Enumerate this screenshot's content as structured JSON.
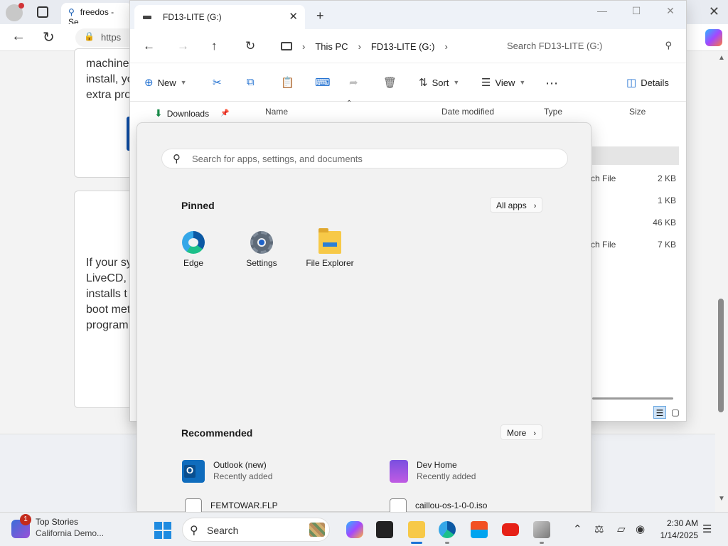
{
  "browser": {
    "tab_title": "freedos - Se",
    "url_text": "https",
    "card1_lines": [
      "machine",
      "install, yo",
      "extra pro"
    ],
    "card2_lines": [
      "If your sy",
      "LiveCD, t",
      "installs t",
      "boot met",
      "program"
    ]
  },
  "explorer": {
    "tab_title": "FD13-LITE (G:)",
    "breadcrumb": [
      "This PC",
      "FD13-LITE (G:)"
    ],
    "search_placeholder": "Search FD13-LITE (G:)",
    "commands": {
      "new": "New",
      "sort": "Sort",
      "view": "View",
      "details": "Details"
    },
    "columns": {
      "name": "Name",
      "date_modified": "Date modified",
      "type": "Type",
      "size": "Size"
    },
    "nav_downloads": "Downloads",
    "rows": [
      {
        "type": "ch File",
        "size": "2 KB"
      },
      {
        "type": "",
        "size": "1 KB"
      },
      {
        "type": "",
        "size": "46 KB"
      },
      {
        "type": "ch File",
        "size": "7 KB"
      }
    ]
  },
  "start_menu": {
    "search_placeholder": "Search for apps, settings, and documents",
    "pinned_heading": "Pinned",
    "all_apps_label": "All apps",
    "pinned": [
      {
        "label": "Edge",
        "icon": "edge-icon"
      },
      {
        "label": "Settings",
        "icon": "settings-gear-icon"
      },
      {
        "label": "File Explorer",
        "icon": "folder-icon"
      }
    ],
    "recommended_heading": "Recommended",
    "more_label": "More",
    "recommended": [
      {
        "title": "Outlook (new)",
        "subtitle": "Recently added",
        "icon": "outlook-icon"
      },
      {
        "title": "Dev Home",
        "subtitle": "Recently added",
        "icon": "dev-home-icon"
      },
      {
        "title": "FEMTOWAR.FLP",
        "subtitle": "",
        "icon": "file-icon"
      },
      {
        "title": "caillou-os-1-0-0.iso",
        "subtitle": "",
        "icon": "disc-image-icon"
      }
    ]
  },
  "taskbar": {
    "widget_title": "Top Stories",
    "widget_subtitle": "California Demo...",
    "widget_badge": "1",
    "search_label": "Search",
    "time": "2:30 AM",
    "date": "1/14/2025"
  },
  "colors": {
    "accent": "#1f6fd0",
    "windows_blue": "#1f8be0",
    "badge_red": "#c42b1c"
  }
}
